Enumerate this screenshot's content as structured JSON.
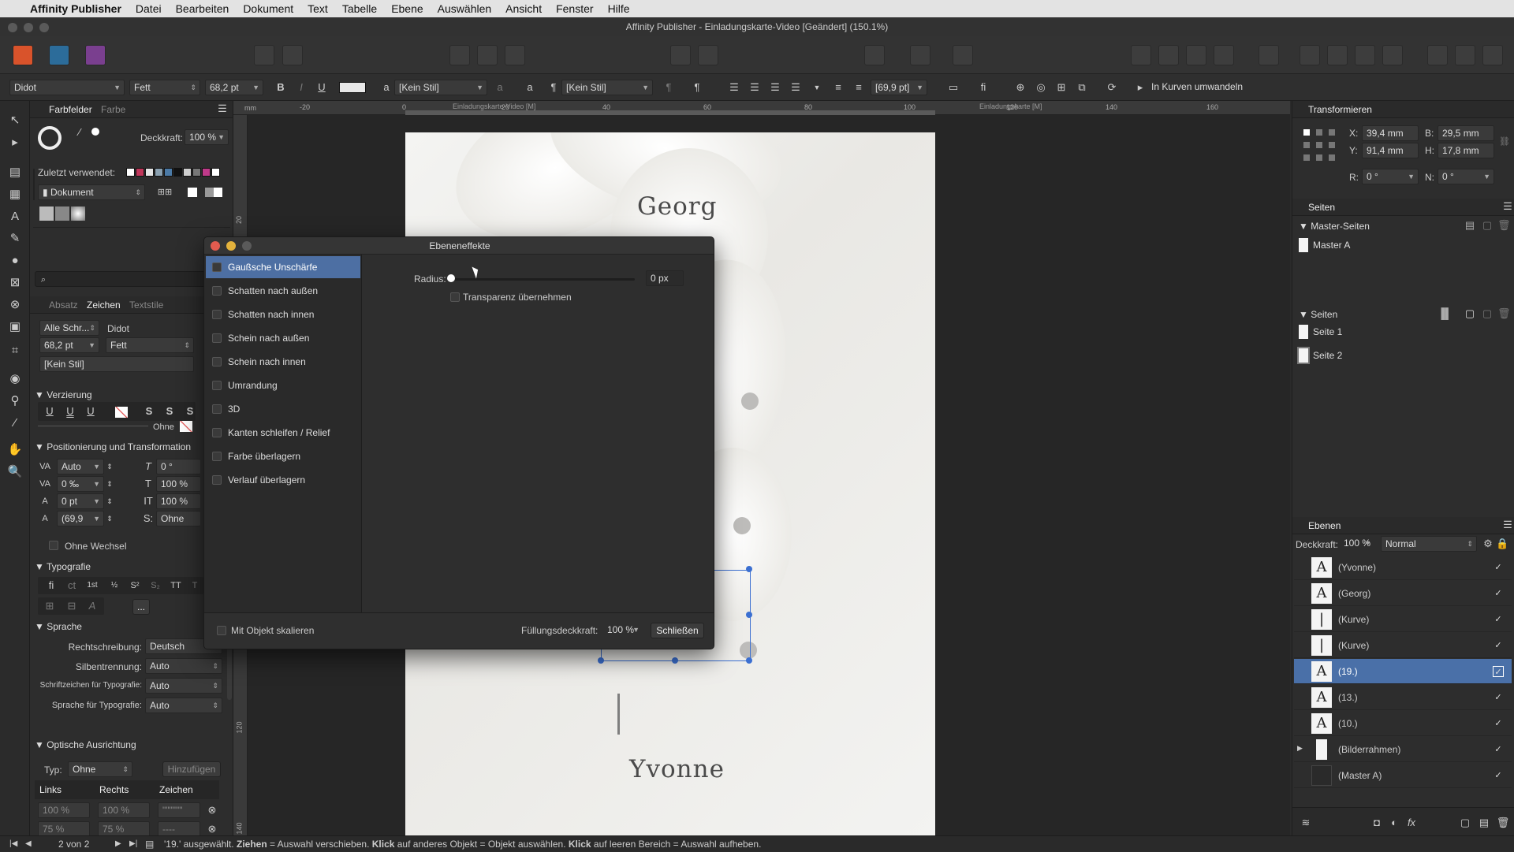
{
  "menubar": {
    "app": "Affinity Publisher",
    "items": [
      "Datei",
      "Bearbeiten",
      "Dokument",
      "Text",
      "Tabelle",
      "Ebene",
      "Auswählen",
      "Ansicht",
      "Fenster",
      "Hilfe"
    ]
  },
  "window": {
    "title": "Affinity Publisher - Einladungskarte-Video [Geändert] (150.1%)"
  },
  "context": {
    "font": "Didot",
    "weight": "Fett",
    "size": "68,2 pt",
    "char_style": "[Kein Stil]",
    "para_style": "[Kein Stil]",
    "leading": "[69,9 pt]",
    "convert": "In Kurven umwandeln"
  },
  "left": {
    "tabs": {
      "swatches": "Farbfelder",
      "color": "Farbe"
    },
    "opacity_label": "Deckkraft:",
    "opacity": "100 %",
    "recent_label": "Zuletzt verwendet:",
    "palette": "Dokument",
    "subtabs": {
      "para": "Absatz",
      "char": "Zeichen",
      "styles": "Textstile"
    },
    "all_fonts": "Alle Schr...",
    "font": "Didot",
    "size": "68,2 pt",
    "weight": "Fett",
    "style": "[Kein Stil]",
    "deco": {
      "title": "Verzierung",
      "none": "Ohne"
    },
    "pos": {
      "title": "Positionierung und Transformation",
      "kern": "Auto",
      "track": "0 ‰",
      "baseline": "0 pt",
      "leading": "(69,9",
      "shear": "0 °",
      "vscale": "100 %",
      "hscale": "100 %",
      "break": "Ohne",
      "nobreak": "Ohne Wechsel"
    },
    "typo": {
      "title": "Typografie",
      "more": "..."
    },
    "lang": {
      "title": "Sprache",
      "spell_label": "Rechtschreibung:",
      "spell": "Deutsch",
      "hyph_label": "Silbentrennung:",
      "hyph": "Auto",
      "chars_label": "Schriftzeichen für Typografie:",
      "chars": "Auto",
      "langt_label": "Sprache für Typografie:",
      "langt": "Auto"
    },
    "optical": {
      "title": "Optische Ausrichtung",
      "type_label": "Typ:",
      "type": "Ohne",
      "add": "Hinzufügen",
      "cols": [
        "Links",
        "Rechts",
        "Zeichen"
      ],
      "row1": [
        "100 %",
        "100 %",
        "\"\"\"\"\"\""
      ],
      "row2": [
        "75 %",
        "75 %",
        "----"
      ]
    }
  },
  "canvas": {
    "tab1": "Einladungskarte-Video [M]",
    "tab2": "Einladungskarte [M]",
    "ruler": [
      "-20",
      "0",
      "20",
      "40",
      "60",
      "80",
      "100",
      "120",
      "140",
      "160"
    ],
    "vruler": [
      "20",
      "120",
      "140"
    ],
    "name1": "Georg",
    "name2": "Yvonne",
    "unit": "mm"
  },
  "dialog": {
    "title": "Ebeneneffekte",
    "effects": [
      "Gaußsche Unschärfe",
      "Schatten nach außen",
      "Schatten nach innen",
      "Schein nach außen",
      "Schein nach innen",
      "Umrandung",
      "3D",
      "Kanten schleifen / Relief",
      "Farbe überlagern",
      "Verlauf überlagern"
    ],
    "radius_label": "Radius:",
    "radius_value": "0 px",
    "radius_fraction": 0,
    "transparency": "Transparenz übernehmen",
    "scale": "Mit Objekt skalieren",
    "fill_label": "Füllungsdeckkraft:",
    "fill_value": "100 %",
    "close": "Schließen"
  },
  "right": {
    "transform": {
      "title": "Transformieren",
      "x_label": "X:",
      "x": "39,4 mm",
      "y_label": "Y:",
      "y": "91,4 mm",
      "b_label": "B:",
      "b": "29,5 mm",
      "h_label": "H:",
      "h": "17,8 mm",
      "r_label": "R:",
      "r": "0 °",
      "n_label": "N:",
      "n": "0 °"
    },
    "pages": {
      "title": "Seiten",
      "masters_title": "Master-Seiten",
      "master": "Master A",
      "pages_title": "Seiten",
      "page1": "Seite 1",
      "page2": "Seite 2"
    },
    "layers": {
      "title": "Ebenen",
      "opacity_label": "Deckkraft:",
      "opacity": "100 %",
      "blend": "Normal",
      "items": [
        {
          "name": "(Yvonne)",
          "kind": "text"
        },
        {
          "name": "(Georg)",
          "kind": "text"
        },
        {
          "name": "(Kurve)",
          "kind": "curve"
        },
        {
          "name": "(Kurve)",
          "kind": "curve"
        },
        {
          "name": "(19.)",
          "kind": "text",
          "selected": true
        },
        {
          "name": "(13.)",
          "kind": "text"
        },
        {
          "name": "(10.)",
          "kind": "text"
        },
        {
          "name": "(Bilderrahmen)",
          "kind": "frame"
        },
        {
          "name": "(Master A)",
          "kind": "master"
        }
      ]
    }
  },
  "status": {
    "pages": "2 von 2",
    "msg_prefix": "'19.' ausgewählt. ",
    "k1": "Ziehen",
    "m1": " = Auswahl verschieben. ",
    "k2": "Klick",
    "m2": " auf anderes Objekt = Objekt auswählen. ",
    "k3": "Klick",
    "m3": " auf leeren Bereich = Auswahl aufheben."
  },
  "colors": {
    "accent": "#4d6fa3",
    "selection": "#3b6fd1"
  }
}
